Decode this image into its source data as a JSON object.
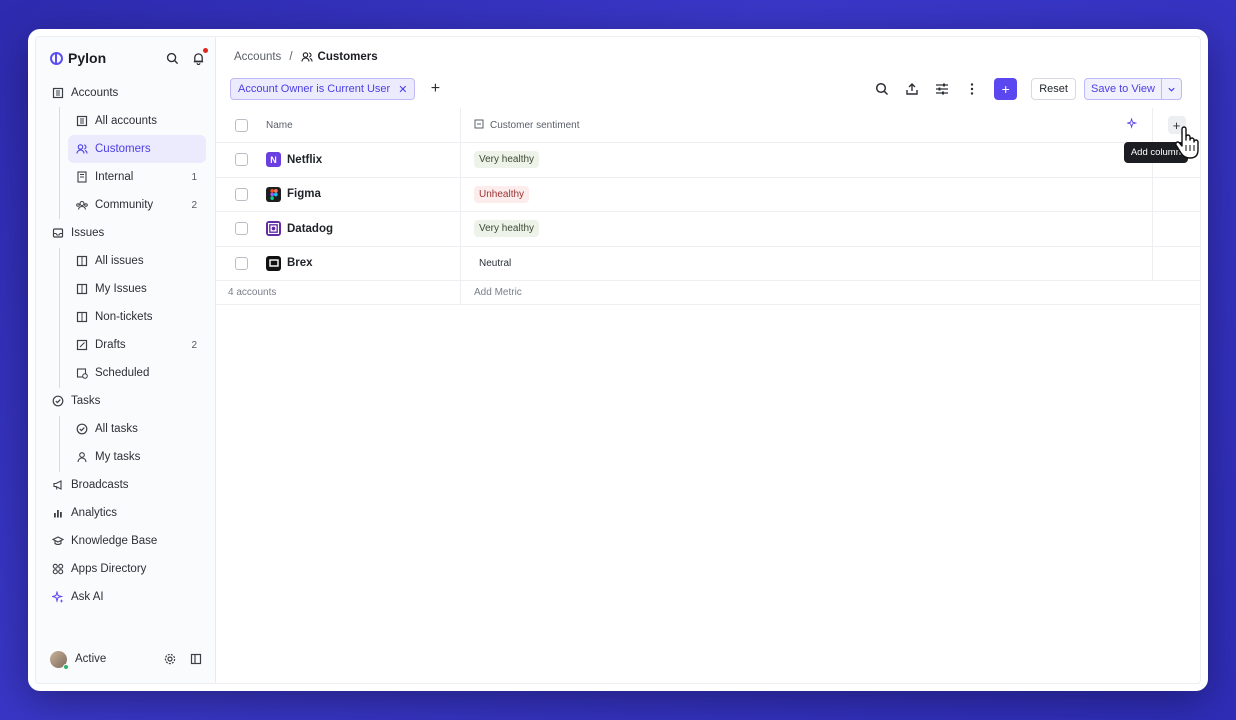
{
  "app": {
    "name": "Pylon"
  },
  "sidebar": {
    "items": [
      {
        "label": "Accounts",
        "icon": "building-icon",
        "level": 0
      },
      {
        "label": "All accounts",
        "icon": "building-icon",
        "level": 1
      },
      {
        "label": "Customers",
        "icon": "users-icon",
        "level": 1,
        "active": true
      },
      {
        "label": "Internal",
        "icon": "office-icon",
        "level": 1,
        "count": "1"
      },
      {
        "label": "Community",
        "icon": "community-icon",
        "level": 1,
        "count": "2"
      },
      {
        "label": "Issues",
        "icon": "inbox-icon",
        "level": 0
      },
      {
        "label": "All issues",
        "icon": "columns-icon",
        "level": 1
      },
      {
        "label": "My Issues",
        "icon": "columns-icon",
        "level": 1
      },
      {
        "label": "Non-tickets",
        "icon": "columns-icon",
        "level": 1
      },
      {
        "label": "Drafts",
        "icon": "draft-icon",
        "level": 1,
        "count": "2"
      },
      {
        "label": "Scheduled",
        "icon": "calendar-clock-icon",
        "level": 1
      },
      {
        "label": "Tasks",
        "icon": "check-circle-icon",
        "level": 0
      },
      {
        "label": "All tasks",
        "icon": "check-circle-icon",
        "level": 1
      },
      {
        "label": "My tasks",
        "icon": "user-icon",
        "level": 1
      },
      {
        "label": "Broadcasts",
        "icon": "megaphone-icon",
        "level": 0
      },
      {
        "label": "Analytics",
        "icon": "bar-chart-icon",
        "level": 0
      },
      {
        "label": "Knowledge Base",
        "icon": "graduation-cap-icon",
        "level": 0
      },
      {
        "label": "Apps Directory",
        "icon": "apps-icon",
        "level": 0
      },
      {
        "label": "Ask AI",
        "icon": "sparkle-icon",
        "level": 0
      }
    ],
    "status_label": "Active"
  },
  "breadcrumb": {
    "parent": "Accounts",
    "separator": "/",
    "current": "Customers"
  },
  "filter": {
    "chip_label": "Account Owner is Current User"
  },
  "toolbar": {
    "reset_label": "Reset",
    "save_label": "Save to View"
  },
  "table": {
    "columns": {
      "name": "Name",
      "sentiment": "Customer sentiment"
    },
    "rows": [
      {
        "name": "Netflix",
        "logo_letter": "N",
        "logo_color": "#6a3fe0",
        "sentiment": "Very healthy",
        "tone": "good"
      },
      {
        "name": "Figma",
        "logo_letter": "F",
        "logo_color": "#1e1e1e",
        "sentiment": "Unhealthy",
        "tone": "bad"
      },
      {
        "name": "Datadog",
        "logo_letter": "D",
        "logo_color": "#632ca6",
        "sentiment": "Very healthy",
        "tone": "good"
      },
      {
        "name": "Brex",
        "logo_letter": "B",
        "logo_color": "#111111",
        "sentiment": "Neutral",
        "tone": "neutral"
      }
    ],
    "footer": {
      "count_label": "4 accounts",
      "metric_label": "Add Metric"
    }
  },
  "tooltip": {
    "text": "Add column"
  },
  "colors": {
    "accent": "#5a47f0",
    "background": "#3a37c8"
  }
}
